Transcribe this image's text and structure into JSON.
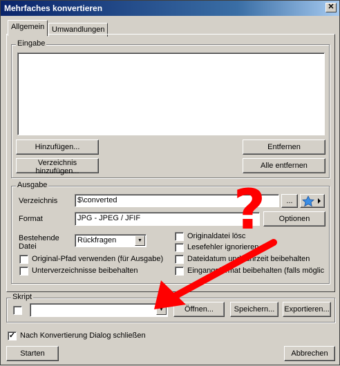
{
  "window": {
    "title": "Mehrfaches konvertieren",
    "close_glyph": "✕"
  },
  "tabs": [
    {
      "label": "Allgemein",
      "active": true
    },
    {
      "label": "Umwandlungen",
      "active": false
    }
  ],
  "eingabe": {
    "label": "Eingabe",
    "buttons": {
      "add": "Hinzufügen...",
      "remove": "Entfernen",
      "add_dir": "Verzeichnis hinzufügen...",
      "remove_all": "Alle entfernen"
    }
  },
  "ausgabe": {
    "label": "Ausgabe",
    "dir_label": "Verzeichnis",
    "dir_value": "$\\converted",
    "browse": "...",
    "format_label": "Format",
    "format_value": "JPG - JPEG / JFIF",
    "options": "Optionen",
    "existing_label_line1": "Bestehende",
    "existing_label_line2": "Datei",
    "existing_value": "Rückfragen",
    "checks_left": [
      {
        "label": "Original-Pfad verwenden (für Ausgabe)",
        "checked": false
      },
      {
        "label": "Unterverzeichnisse beibehalten",
        "checked": false
      }
    ],
    "checks_right": [
      {
        "label": "Originaldatei lösc",
        "checked": false
      },
      {
        "label": "Lesefehler ignorieren",
        "checked": false
      },
      {
        "label": "Dateidatum und -uhrzeit beibehalten",
        "checked": false
      },
      {
        "label": "Eingangsformat beibehalten (falls möglic",
        "checked": false
      }
    ]
  },
  "skript": {
    "label": "Skript",
    "checked": false,
    "value": "",
    "open": "Öffnen...",
    "save": "Speichern...",
    "export": "Exportieren..."
  },
  "close_after": {
    "label": "Nach Konvertierung Dialog schließen",
    "checked": true
  },
  "footer": {
    "start": "Starten",
    "cancel": "Abbrechen"
  },
  "annotation": {
    "question_mark": "?",
    "color": "#ff0000"
  },
  "colors": {
    "face": "#d4d0c8",
    "title_start": "#0a246a",
    "title_end": "#a6caf0",
    "star": "#3a8ee6"
  }
}
